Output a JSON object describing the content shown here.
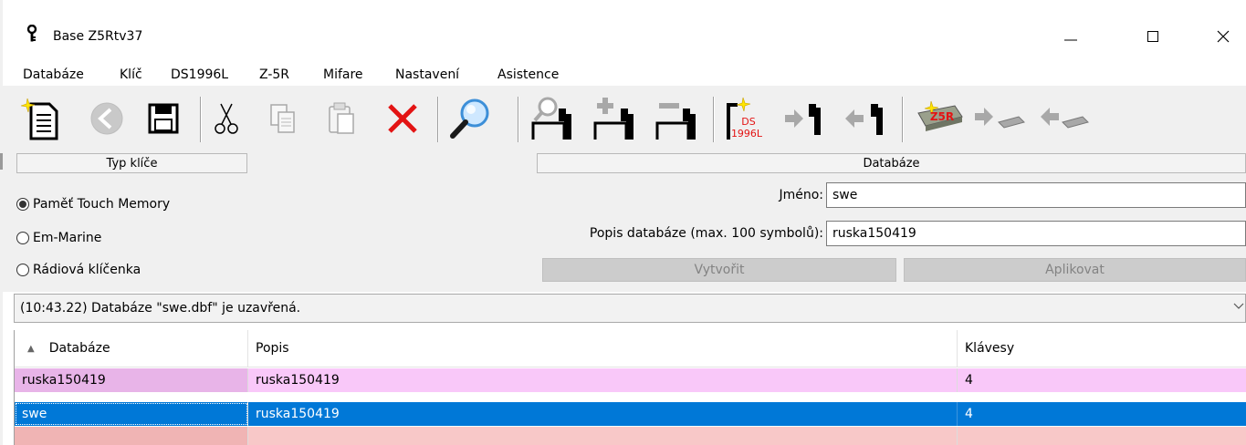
{
  "window": {
    "title": "Base Z5Rtv37",
    "minimize_glyph": "—",
    "close_glyph": "✕"
  },
  "menu": [
    "Databáze",
    "Klíč",
    "DS1996L",
    "Z-5R",
    "Mifare",
    "Nastavení",
    "Asistence"
  ],
  "toolbar": {
    "icons": [
      "new-file-icon",
      "back-icon",
      "save-icon",
      "cut-icon",
      "copy-icon",
      "paste-icon",
      "delete-icon",
      "search-icon",
      "find-key-icon",
      "add-key-icon",
      "remove-key-icon",
      "ds1996l-icon",
      "read-key-icon",
      "write-key-icon",
      "z5r-icon",
      "read-z5r-icon",
      "write-z5r-icon"
    ],
    "ds1996l_badge": "DS\n1996L",
    "z5r_badge": "Z5R"
  },
  "key_type": {
    "header": "Typ klíče",
    "options": [
      "Paměť Touch Memory",
      "Em-Marine",
      "Rádiová klíčenka"
    ],
    "selected_index": 0
  },
  "database_form": {
    "header": "Databáze",
    "name_label": "Jméno:",
    "name_value": "swe",
    "desc_label": "Popis databáze (max. 100 symbolů):",
    "desc_value": "ruska150419",
    "create_label": "Vytvořit",
    "apply_label": "Aplikovat"
  },
  "status": {
    "message": "(10:43.22) Databáze \"swe.dbf\" je uzavřená."
  },
  "table": {
    "columns": [
      "Databáze",
      "Popis",
      "Klávesy"
    ],
    "sort_glyph": "▲",
    "rows": [
      {
        "database": "ruska150419",
        "description": "ruska150419",
        "keys": "4",
        "selected": false
      },
      {
        "database": "swe",
        "description": "ruska150419",
        "keys": "4",
        "selected": true
      }
    ]
  },
  "colors": {
    "row_pink_first": "#e8b4e8",
    "row_pink": "#f9c8f9",
    "row_selected": "#0078d7",
    "row_empty_first": "#f0b4b4",
    "row_empty": "#f8c8c8"
  }
}
